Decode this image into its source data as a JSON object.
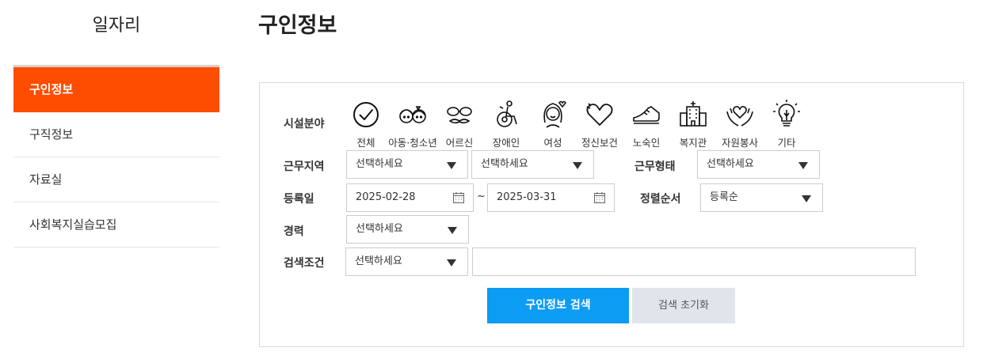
{
  "sidebar": {
    "title": "일자리",
    "items": [
      {
        "label": "구인정보",
        "active": true
      },
      {
        "label": "구직정보",
        "active": false
      },
      {
        "label": "자료실",
        "active": false
      },
      {
        "label": "사회복지실습모집",
        "active": false
      }
    ]
  },
  "page": {
    "title": "구인정보"
  },
  "search": {
    "facility_label": "시설분야",
    "categories": [
      {
        "label": "전체",
        "icon": "check-circle-icon"
      },
      {
        "label": "아동·청소년",
        "icon": "child-youth-icon"
      },
      {
        "label": "어르신",
        "icon": "elderly-glasses-icon"
      },
      {
        "label": "장애인",
        "icon": "wheelchair-icon"
      },
      {
        "label": "여성",
        "icon": "woman-icon"
      },
      {
        "label": "정신보건",
        "icon": "heart-icon"
      },
      {
        "label": "노숙인",
        "icon": "shoe-icon"
      },
      {
        "label": "복지관",
        "icon": "building-icon"
      },
      {
        "label": "자원봉사",
        "icon": "volunteer-hands-icon"
      },
      {
        "label": "기타",
        "icon": "lightbulb-icon"
      }
    ],
    "region_label": "근무지역",
    "region_select_1": "선택하세요",
    "region_select_2": "선택하세요",
    "worktype_label": "근무형태",
    "worktype_select": "선택하세요",
    "date_label": "등록일",
    "date_from": "2025-02-28",
    "date_separator": "~",
    "date_to": "2025-03-31",
    "sort_label": "정렬순서",
    "sort_select": "등록순",
    "career_label": "경력",
    "career_select": "선택하세요",
    "condition_label": "검색조건",
    "condition_select": "선택하세요",
    "keyword_value": "",
    "search_button": "구인정보 검색",
    "reset_button": "검색 초기화"
  },
  "colors": {
    "accent_orange": "#ff4d00",
    "primary_blue": "#0c9cf4",
    "reset_gray": "#e2e4ec"
  }
}
